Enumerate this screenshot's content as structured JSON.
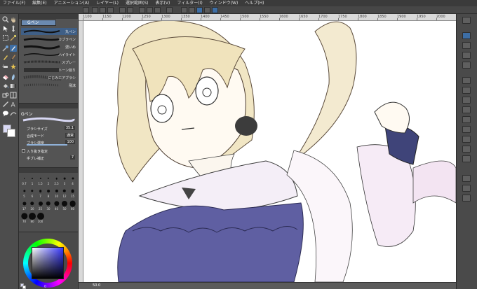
{
  "menu": [
    "ファイル(F)",
    "編集(E)",
    "アニメーション(A)",
    "レイヤー(L)",
    "選択範囲(S)",
    "表示(V)",
    "フィルター(I)",
    "ウィンドウ(W)",
    "ヘルプ(H)"
  ],
  "subtool": {
    "tab_label": "Gペン",
    "brushes": [
      {
        "label": "丸ペン"
      },
      {
        "label": "カブラペン"
      },
      {
        "label": "濃いめ"
      },
      {
        "label": "ハイライト"
      },
      {
        "label": "スプレー"
      },
      {
        "label": "トーン削り"
      },
      {
        "label": "にじみエアブラシ"
      },
      {
        "label": "飛沫"
      }
    ]
  },
  "tool_property": {
    "name": "Gペン",
    "brush_size_label": "ブラシサイズ",
    "brush_size_value": "35.1",
    "blend_label": "合成モード",
    "blend_value": "通常",
    "density_label": "ブラシ濃度",
    "density_value": "100",
    "density_percent": 100,
    "stabilize_label": "手ブレ補正",
    "stabilize_value": "7",
    "opt1_label": "入り抜き指定"
  },
  "brush_sizes": [
    "0.7",
    "1",
    "1.5",
    "2",
    "2.5",
    "3",
    "4",
    "5",
    "6",
    "7",
    "8",
    "10",
    "12",
    "15",
    "17",
    "20",
    "25",
    "30",
    "40",
    "50",
    "60",
    "70",
    "80",
    "100"
  ],
  "color": {
    "main": "#d8d8f4",
    "sub": "#ffffff",
    "hsv_value": "0"
  },
  "ruler_labels": [
    "1100",
    "1150",
    "1200",
    "1250",
    "1300",
    "1350",
    "1400",
    "1450",
    "1500",
    "1550",
    "1600",
    "1650",
    "1700",
    "1750",
    "1800",
    "1850",
    "1900",
    "1950",
    "2000"
  ],
  "status": {
    "zoom": "50.0"
  },
  "icons": {
    "tools": [
      "zoom-icon",
      "hand-icon",
      "eyedropper-icon",
      "pen-icon",
      "pencil-icon",
      "brush-icon",
      "airbrush-icon",
      "decoration-icon",
      "eraser-icon",
      "fill-icon",
      "gradient-icon",
      "figure-icon",
      "text-icon",
      "balloon-icon",
      "line-icon",
      "select-icon",
      "move-icon"
    ]
  },
  "accent": "#3d6ea5"
}
